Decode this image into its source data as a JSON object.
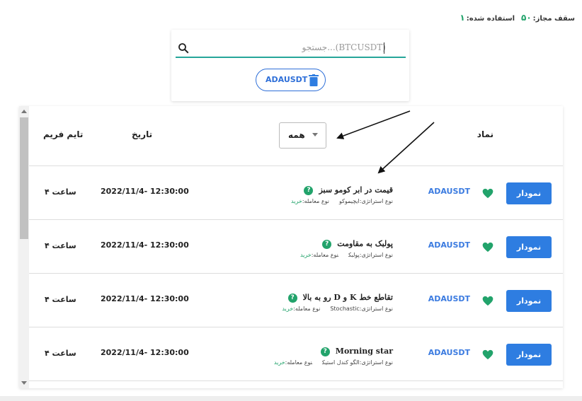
{
  "quota": {
    "label_limit": "سقف مجاز:",
    "limit": "۵۰",
    "label_used": "استفاده شده:",
    "used": "۱"
  },
  "search": {
    "placeholder": "جستجو...(BTCUSDT)"
  },
  "selected_chips": [
    {
      "label": "ADAUSDT"
    }
  ],
  "table": {
    "headers": {
      "timeframe": "تایم فریم",
      "date": "تاریخ",
      "symbol": "نماد"
    },
    "filter": {
      "selected": "همه"
    },
    "rows": [
      {
        "timeframe": "۴ ساعت",
        "date": "2022/11/4- 12:30:00",
        "strategy_title": "قیمت در ابر کومو سبز",
        "strategy_type_label": "نوع استراتژی:",
        "strategy_type": "ایچیموکو",
        "trade_type_label": "نوع معامله:",
        "trade_type": "خرید",
        "symbol": "ADAUSDT",
        "button": "نمودار"
      },
      {
        "timeframe": "۴ ساعت",
        "date": "2022/11/4- 12:30:00",
        "strategy_title": "پولبک به مقاومت",
        "strategy_type_label": "نوع استراتژی:",
        "strategy_type": "پولبک",
        "trade_type_label": "نوع معامله:",
        "trade_type": "خرید",
        "symbol": "ADAUSDT",
        "button": "نمودار"
      },
      {
        "timeframe": "۴ ساعت",
        "date": "2022/11/4- 12:30:00",
        "strategy_title": "تقاطع خط K و D رو به بالا",
        "strategy_type_label": "نوع استراتژی:",
        "strategy_type": "Stochastic",
        "trade_type_label": "نوع معامله:",
        "trade_type": "خرید",
        "symbol": "ADAUSDT",
        "button": "نمودار"
      },
      {
        "timeframe": "۴ ساعت",
        "date": "2022/11/4- 12:30:00",
        "strategy_title": "Morning star",
        "strategy_type_label": "نوع استراتژی:",
        "strategy_type": "الگو کندل استیک",
        "trade_type_label": "نوع معامله:",
        "trade_type": "خرید",
        "symbol": "ADAUSDT",
        "button": "نمودار"
      }
    ]
  },
  "colors": {
    "accent": "#2e7de1",
    "green": "#22a36b",
    "underline": "#26a69a"
  }
}
